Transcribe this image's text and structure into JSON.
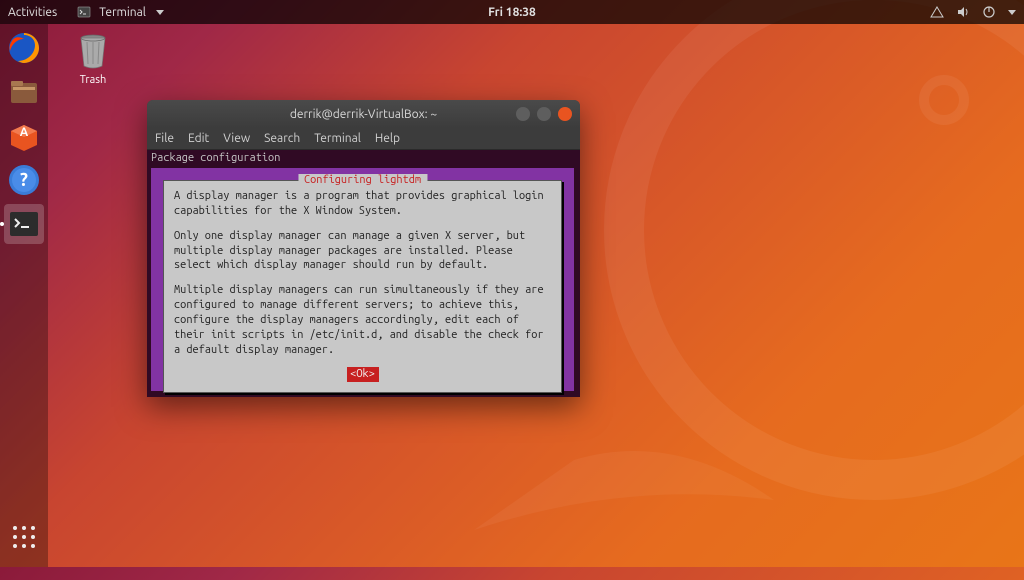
{
  "top_panel": {
    "activities": "Activities",
    "active_app": "Terminal",
    "clock": "Fri 18:38"
  },
  "desktop": {
    "trash_label": "Trash"
  },
  "dock": {
    "items": [
      {
        "name": "firefox-icon"
      },
      {
        "name": "files-icon"
      },
      {
        "name": "software-icon"
      },
      {
        "name": "help-icon"
      },
      {
        "name": "terminal-icon"
      }
    ]
  },
  "terminal": {
    "title": "derrik@derrik-VirtualBox: ~",
    "menu": {
      "file": "File",
      "edit": "Edit",
      "view": "View",
      "search": "Search",
      "terminal": "Terminal",
      "help": "Help"
    },
    "header": "Package configuration",
    "dialog_title": "Configuring lightdm",
    "paragraph1": "A display manager is a program that provides graphical login capabilities for the X Window System.",
    "paragraph2": "Only one display manager can manage a given X server, but multiple display manager packages are installed. Please select which display manager should run by default.",
    "paragraph3": "Multiple display managers can run simultaneously if they are configured to manage different servers; to achieve this, configure the display managers accordingly, edit each of their init scripts in /etc/init.d, and disable the check for a default display manager.",
    "ok_label": "<Ok>"
  }
}
